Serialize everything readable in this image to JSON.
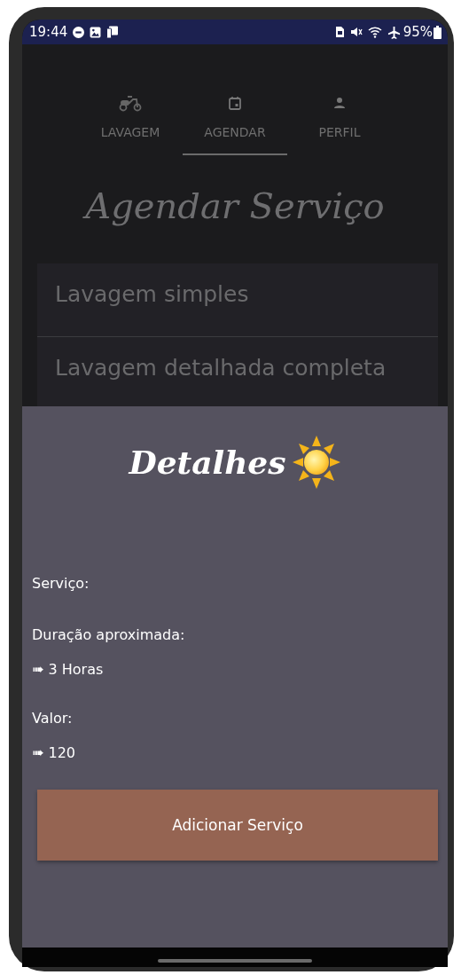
{
  "status_bar": {
    "time": "19:44",
    "battery": "95%"
  },
  "tabs": [
    {
      "label": "LAVAGEM",
      "selected": false
    },
    {
      "label": "AGENDAR",
      "selected": true
    },
    {
      "label": "PERFIL",
      "selected": false
    }
  ],
  "title": "Agendar Serviço",
  "services": [
    "Lavagem simples",
    "Lavagem detalhada completa"
  ],
  "details": {
    "title": "Detalhes",
    "fields": [
      {
        "label": "Serviço:"
      },
      {
        "label": "Duração aproximada:",
        "value": "➠ 3 Horas"
      },
      {
        "label": "Valor:",
        "value": "➠ 120"
      }
    ],
    "button": "Adicionar Serviço"
  }
}
